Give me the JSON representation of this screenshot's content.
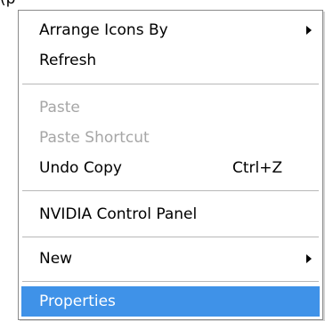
{
  "top_fragment": "(p",
  "menu": {
    "items": [
      {
        "label": "Arrange Icons By"
      },
      {
        "label": "Refresh"
      },
      {
        "label": "Paste"
      },
      {
        "label": "Paste Shortcut"
      },
      {
        "label": "Undo Copy",
        "shortcut": "Ctrl+Z"
      },
      {
        "label": "NVIDIA Control Panel"
      },
      {
        "label": "New"
      },
      {
        "label": "Properties"
      }
    ]
  },
  "colors": {
    "highlight": "#3f92e8",
    "disabled_text": "#a6a6a6",
    "separator": "#b8b8b8"
  },
  "icons": {
    "arrange_submenu": "chevron-right-icon",
    "new_submenu": "chevron-right-icon"
  }
}
